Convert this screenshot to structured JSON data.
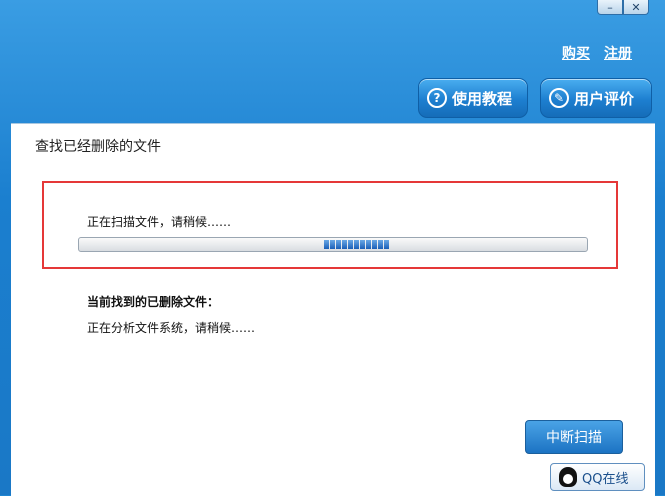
{
  "window": {
    "minimize_glyph": "–",
    "close_glyph": "✕"
  },
  "header": {
    "buy_link": "购买",
    "register_link": "注册",
    "tutorial_button": "使用教程",
    "review_button": "用户评价",
    "tutorial_icon": "?",
    "review_icon": "✎"
  },
  "main": {
    "title": "查找已经删除的文件",
    "scan_status": "正在扫描文件，请稍候……",
    "progress_segments": 11,
    "found_label": "当前找到的已删除文件：",
    "analysis_status": "正在分析文件系统，请稍候……",
    "stop_button": "中断扫描"
  },
  "footer": {
    "qq_button": "QQ在线"
  },
  "colors": {
    "highlight_border": "#e53838",
    "header_blue": "#1b7fcf"
  }
}
